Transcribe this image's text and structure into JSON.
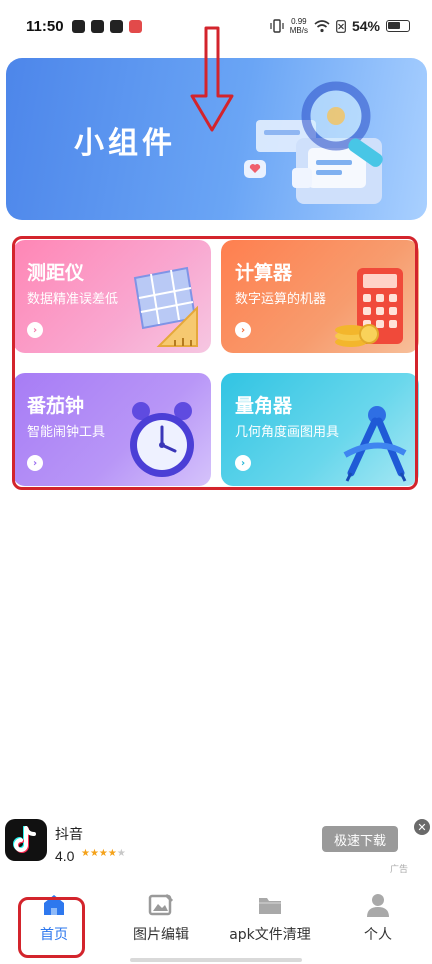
{
  "status_bar": {
    "time": "11:50",
    "net_speed_value": "0.99",
    "net_speed_unit": "MB/s",
    "battery": "54%"
  },
  "banner": {
    "title": "小组件"
  },
  "widgets": [
    {
      "title": "测距仪",
      "desc": "数据精准误差低",
      "icon": "ruler-icon",
      "color": "#ff86b5"
    },
    {
      "title": "计算器",
      "desc": "数字运算的机器",
      "icon": "calculator-icon",
      "color": "#ff7f4f"
    },
    {
      "title": "番茄钟",
      "desc": "智能闹钟工具",
      "icon": "alarm-clock-icon",
      "color": "#a77cf5"
    },
    {
      "title": "量角器",
      "desc": "几何角度画图用具",
      "icon": "compass-icon",
      "color": "#31c4e3"
    }
  ],
  "ad": {
    "app_name": "抖音",
    "rating": "4.0",
    "stars_filled": 4,
    "stars_total": 5,
    "download_label": "极速下载",
    "tag": "广告"
  },
  "nav": {
    "items": [
      {
        "label": "首页",
        "icon": "home-icon",
        "active": true
      },
      {
        "label": "图片编辑",
        "icon": "image-edit-icon",
        "active": false
      },
      {
        "label": "apk文件清理",
        "icon": "folder-icon",
        "active": false
      },
      {
        "label": "个人",
        "icon": "person-icon",
        "active": false
      }
    ],
    "active_color": "#2e78ee"
  },
  "annotation_color": "#d3242c"
}
